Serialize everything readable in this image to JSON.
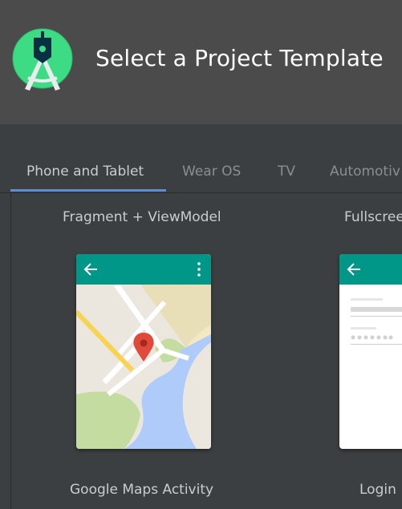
{
  "window": {
    "title": "Select a Project Template"
  },
  "tabs": [
    {
      "label": "Phone and Tablet",
      "active": true
    },
    {
      "label": "Wear OS",
      "active": false
    },
    {
      "label": "TV",
      "active": false
    },
    {
      "label": "Automotiv",
      "active": false
    }
  ],
  "templates": [
    {
      "top_label": "Fragment + ViewModel",
      "name": "Google Maps Activity",
      "preview_icon": "map-preview"
    },
    {
      "top_label": "Fullscree",
      "name": "Login",
      "preview_icon": "login-form-preview"
    }
  ],
  "colors": {
    "header_bg": "#4b4b4b",
    "body_bg": "#3c3f41",
    "accent": "#5f8bd0",
    "app_bar": "#009688",
    "pin_red": "#e04a3b"
  }
}
